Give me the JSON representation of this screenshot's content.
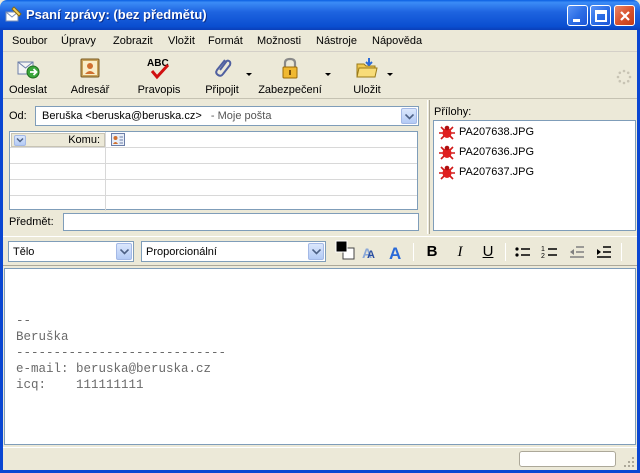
{
  "window": {
    "title": "Psaní zprávy: (bez předmětu)"
  },
  "menu": {
    "items": [
      "Soubor",
      "Úpravy",
      "Zobrazit",
      "Vložit",
      "Formát",
      "Možnosti",
      "Nástroje",
      "Nápověda"
    ]
  },
  "toolbar": {
    "buttons": [
      {
        "label": "Odeslat",
        "icon": "send-icon"
      },
      {
        "label": "Adresář",
        "icon": "address-book-icon"
      },
      {
        "label": "Pravopis",
        "icon": "spellcheck-icon"
      },
      {
        "label": "Připojit",
        "icon": "paperclip-icon"
      },
      {
        "label": "Zabezpečení",
        "icon": "padlock-icon"
      },
      {
        "label": "Uložit",
        "icon": "save-folder-icon"
      }
    ]
  },
  "header": {
    "from_label": "Od:",
    "from_value": "Beruška <beruska@beruska.cz>",
    "from_account": "- Moje pošta",
    "recipient_type": "Komu:",
    "recipient_value": "",
    "subject_label": "Předmět:",
    "subject_value": ""
  },
  "attachments": {
    "label": "Přílohy:",
    "files": [
      "PA207638.JPG",
      "PA207636.JPG",
      "PA207637.JPG"
    ]
  },
  "format_bar": {
    "paragraph_style": "Tělo",
    "font": "Proporcionální",
    "bold_label": "B",
    "italic_label": "I",
    "underline_label": "U",
    "text_color": "#000000"
  },
  "body": {
    "lines": [
      "--",
      "Beruška",
      "----------------------------",
      "e-mail: beruska@beruska.cz",
      "icq:    111111111"
    ]
  },
  "colors": {
    "titlebar": "#0a4ed0",
    "chrome": "#ece9d8",
    "border": "#7f9db9"
  }
}
